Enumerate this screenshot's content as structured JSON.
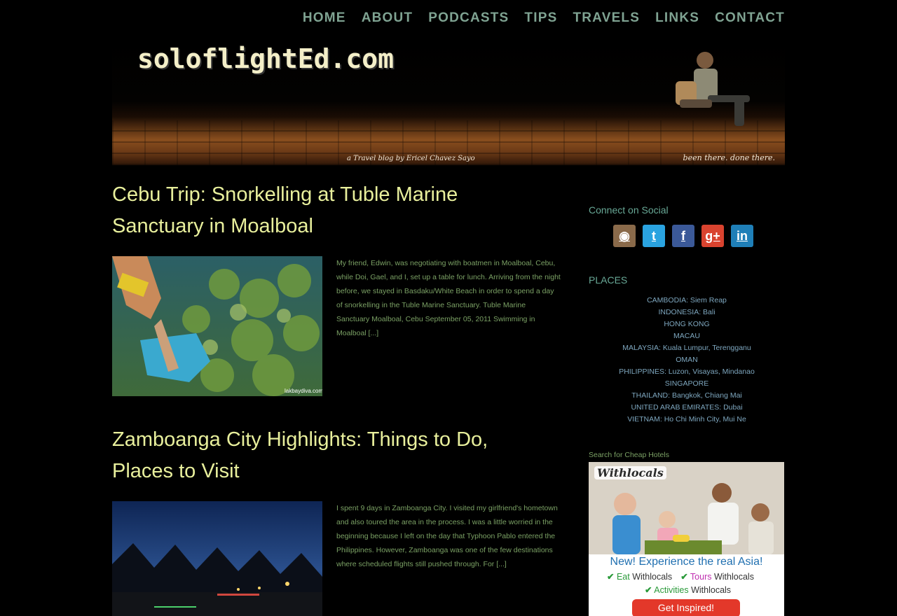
{
  "nav": {
    "items": [
      "HOME",
      "ABOUT",
      "PODCASTS",
      "TIPS",
      "TRAVELS",
      "LINKS",
      "CONTACT"
    ]
  },
  "header": {
    "logo": "soloflightEd.com",
    "tagline": "a Travel blog by Ericel Chavez Sayo",
    "motto": "been there. done there."
  },
  "posts": [
    {
      "title": "Cebu Trip: Snorkelling at Tuble Marine Sanctuary in Moalboal",
      "excerpt": "My friend, Edwin, was negotiating with boatmen in Moalboal, Cebu, while Doi, Gael, and I, set up a table for lunch. Arriving from the night before, we stayed in Basdaku/White Beach in order to spend a day of snorkelling in the Tuble Marine Sanctuary. Tuble Marine Sanctuary Moalboal, Cebu September 05, 2011 Swimming in Moalboal [...]",
      "watermark": "lakbaydiva.com"
    },
    {
      "title": "Zamboanga City Highlights: Things to Do, Places to Visit",
      "excerpt": "I spent 9 days in Zamboanga City. I visited my girlfriend's hometown and also toured the area in the process. I was a little worried in the beginning because I left on the day that Typhoon Pablo entered the Philippines. However, Zamboanga was one of the few destinations where scheduled flights still pushed through. For [...]"
    }
  ],
  "sidebar": {
    "social_heading": "Connect on Social",
    "social_icons": [
      {
        "name": "instagram-icon",
        "glyph": "◉",
        "color": "#8a6a4a"
      },
      {
        "name": "twitter-icon",
        "glyph": "t",
        "color": "#2aa3e0"
      },
      {
        "name": "facebook-icon",
        "glyph": "f",
        "color": "#3b5998"
      },
      {
        "name": "google-plus-icon",
        "glyph": "g+",
        "color": "#d9432f"
      },
      {
        "name": "linkedin-icon",
        "glyph": "in",
        "color": "#1f7fb8"
      }
    ],
    "places_heading": "PLACES",
    "places": [
      "CAMBODIA: Siem Reap",
      "INDONESIA: Bali",
      "HONG KONG",
      "MACAU",
      "MALAYSIA: Kuala Lumpur, Terengganu",
      "OMAN",
      "PHILIPPINES: Luzon, Visayas, Mindanao",
      "SINGAPORE",
      "THAILAND: Bangkok, Chiang Mai",
      "UNITED ARAB EMIRATES: Dubai",
      "VIETNAM: Ho Chi Minh City, Mui Ne"
    ],
    "hotels_heading": "Search for Cheap Hotels",
    "ad": {
      "brand": "Withlocals",
      "headline": "New! Experience the real Asia!",
      "features": [
        {
          "verb": "Eat",
          "rest": "Withlocals"
        },
        {
          "verb": "Tours",
          "rest": "Withlocals"
        },
        {
          "verb": "Activities",
          "rest": "Withlocals"
        }
      ],
      "cta": "Get Inspired!"
    }
  }
}
